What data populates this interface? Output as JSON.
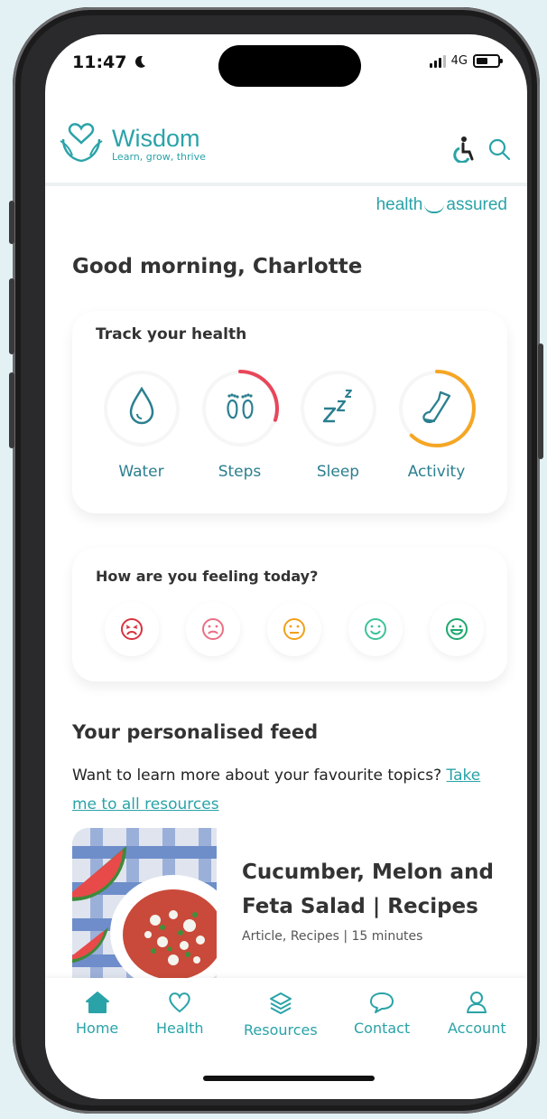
{
  "status_bar": {
    "time": "11:47",
    "network": "4G"
  },
  "header": {
    "brand_name": "Wisdom",
    "tagline": "Learn, grow, thrive",
    "partner_left": "health",
    "partner_right": "assured"
  },
  "greeting": "Good morning, Charlotte",
  "track_card": {
    "title": "Track your health",
    "items": [
      {
        "label": "Water",
        "icon": "water-drop-icon",
        "progress": 0,
        "color": ""
      },
      {
        "label": "Steps",
        "icon": "footprints-icon",
        "progress": 0.3,
        "color": "#e8465a"
      },
      {
        "label": "Sleep",
        "icon": "sleep-zzz-icon",
        "progress": 0,
        "color": ""
      },
      {
        "label": "Activity",
        "icon": "shoe-icon",
        "progress": 0.62,
        "color": "#f5a623"
      }
    ]
  },
  "mood_card": {
    "title": "How are you feeling today?",
    "moods": [
      {
        "icon": "very-sad-face-icon",
        "color": "#d9323f"
      },
      {
        "icon": "sad-face-icon",
        "color": "#ea6f84"
      },
      {
        "icon": "neutral-face-icon",
        "color": "#f0a01c"
      },
      {
        "icon": "happy-face-icon",
        "color": "#3cc39a"
      },
      {
        "icon": "very-happy-face-icon",
        "color": "#1ea96f"
      }
    ]
  },
  "feed": {
    "title": "Your personalised feed",
    "subtitle": "Want to learn more about your favourite topics?",
    "link": "Take me to all resources",
    "article": {
      "title": "Cucumber, Melon and Feta Salad | Recipes",
      "meta": "Article, Recipes | 15 minutes"
    }
  },
  "tabbar": {
    "tabs": [
      {
        "label": "Home",
        "icon": "home-icon",
        "active": true
      },
      {
        "label": "Health",
        "icon": "heart-icon"
      },
      {
        "label": "Resources",
        "icon": "layers-icon"
      },
      {
        "label": "Contact",
        "icon": "chat-bubble-icon"
      },
      {
        "label": "Account",
        "icon": "user-icon"
      }
    ]
  },
  "colors": {
    "brand": "#2aa3a8",
    "background": "#e3f1f4"
  }
}
